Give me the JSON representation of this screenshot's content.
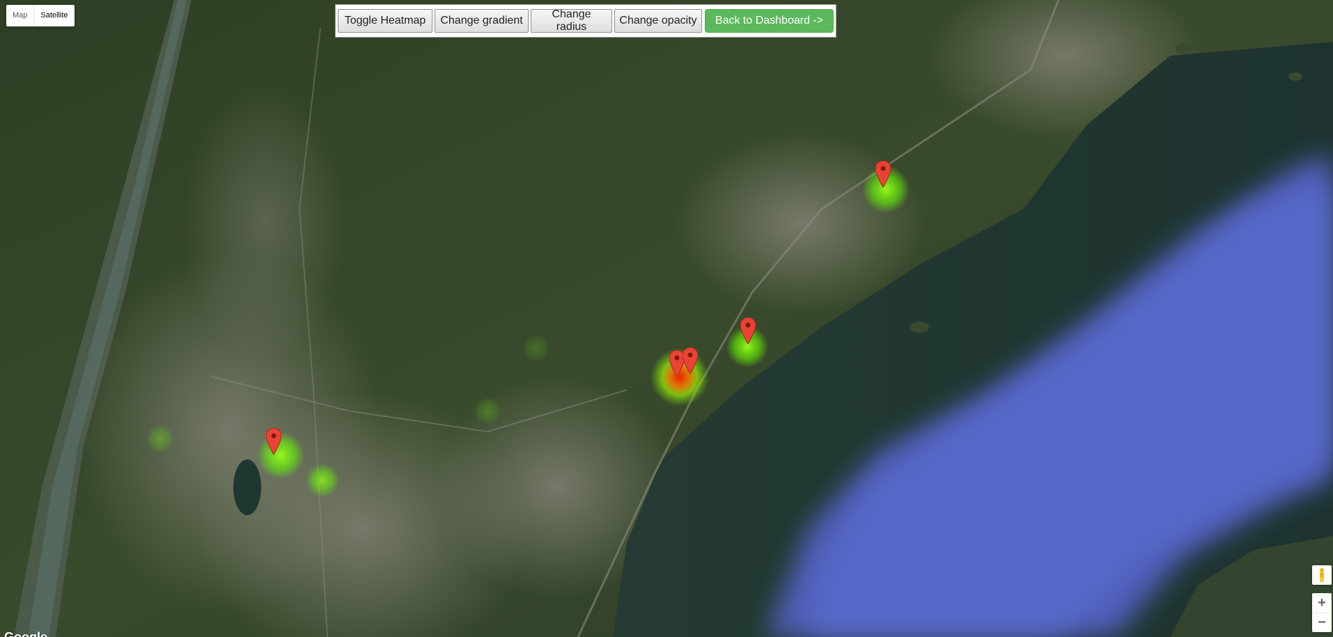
{
  "map_type": {
    "map_label": "Map",
    "satellite_label": "Satellite",
    "selected": "Satellite"
  },
  "controls": {
    "toggle_heatmap": "Toggle Heatmap",
    "change_gradient": "Change gradient",
    "change_radius": "Change radius",
    "change_opacity": "Change opacity",
    "back_to_dashboard": "Back to Dashboard ->"
  },
  "zoom": {
    "in": "+",
    "out": "−"
  },
  "attribution": {
    "logo": "Google"
  },
  "icons": {
    "marker": "map-pin-icon",
    "pegman": "street-view-pegman-icon"
  },
  "colors": {
    "marker_red": "#ea4335",
    "primary_button": "#5cb85c",
    "heat_green": "#66ff00",
    "heat_red": "#ff0000",
    "water": "#4f5fb8"
  }
}
